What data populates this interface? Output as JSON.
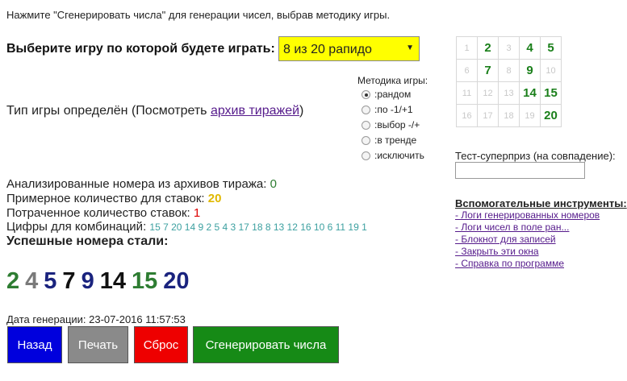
{
  "hint": "Нажмите \"Сгенерировать числа\" для генерации чисел, выбрав методику игры.",
  "game_select": {
    "label": "Выберите игру по которой будете играть:",
    "value": "8 из 20 рапидо",
    "bg_color": "#ffff00"
  },
  "game_type": {
    "text": "Тип игры определён (Посмотреть ",
    "link": "архив тиражей",
    "text_end": ")"
  },
  "method": {
    "title": "Методика игры:",
    "options": [
      ":рандом",
      ":по -1/+1",
      ":выбор -/+",
      ":в тренде",
      ":исключить"
    ],
    "selected": 0
  },
  "number_grid": {
    "rows": [
      [
        "1",
        "2",
        "3",
        "4",
        "5"
      ],
      [
        "6",
        "7",
        "8",
        "9",
        "10"
      ],
      [
        "11",
        "12",
        "13",
        "14",
        "15"
      ],
      [
        "16",
        "17",
        "18",
        "19",
        "20"
      ]
    ],
    "highlighted": [
      "2",
      "4",
      "5",
      "7",
      "9",
      "14",
      "15",
      "20"
    ],
    "highlight_color": "#1a7f1a"
  },
  "test_superprize": {
    "label": "Тест-суперприз (на совпадение):",
    "value": ""
  },
  "tools": {
    "title": "Вспомогательные инструменты:",
    "links": [
      "- Логи генерированных номеров",
      "- Логи чисел в поле ран...",
      "- Блокнот для записей",
      "- Закрыть эти окна",
      "- Справка по программе"
    ]
  },
  "stats": {
    "analyzed_label": "Анализированные номера из архивов тиража: ",
    "analyzed_value": "0",
    "approx_label": "Примерное количество для ставок: ",
    "approx_value": "20",
    "spent_label": "Потраченное количество ставок: ",
    "spent_value": "1",
    "digits_label": "Цифры для комбинаций: ",
    "digits_value": "15 7 20 14 9 2 5 4 3 17 18 8 13 12 16 10 6 11 19 1"
  },
  "success": {
    "title": "Успешные номера стали:",
    "numbers": [
      "2",
      "4",
      "5",
      "7",
      "9",
      "14",
      "15",
      "20"
    ],
    "colors": [
      "#2e7d32",
      "#7a7a7a",
      "#1a237e",
      "#111111",
      "#1a237e",
      "#111111",
      "#2e7d32",
      "#1a237e"
    ]
  },
  "gen_date": "Дата генерации: 23-07-2016 11:57:53",
  "buttons": {
    "back": "Назад",
    "print": "Печать",
    "reset": "Сброс",
    "generate": "Сгенерировать числа"
  },
  "button_colors": {
    "back": "#0000dd",
    "print": "#8a8a8a",
    "reset": "#ee0000",
    "generate": "#168a16"
  }
}
